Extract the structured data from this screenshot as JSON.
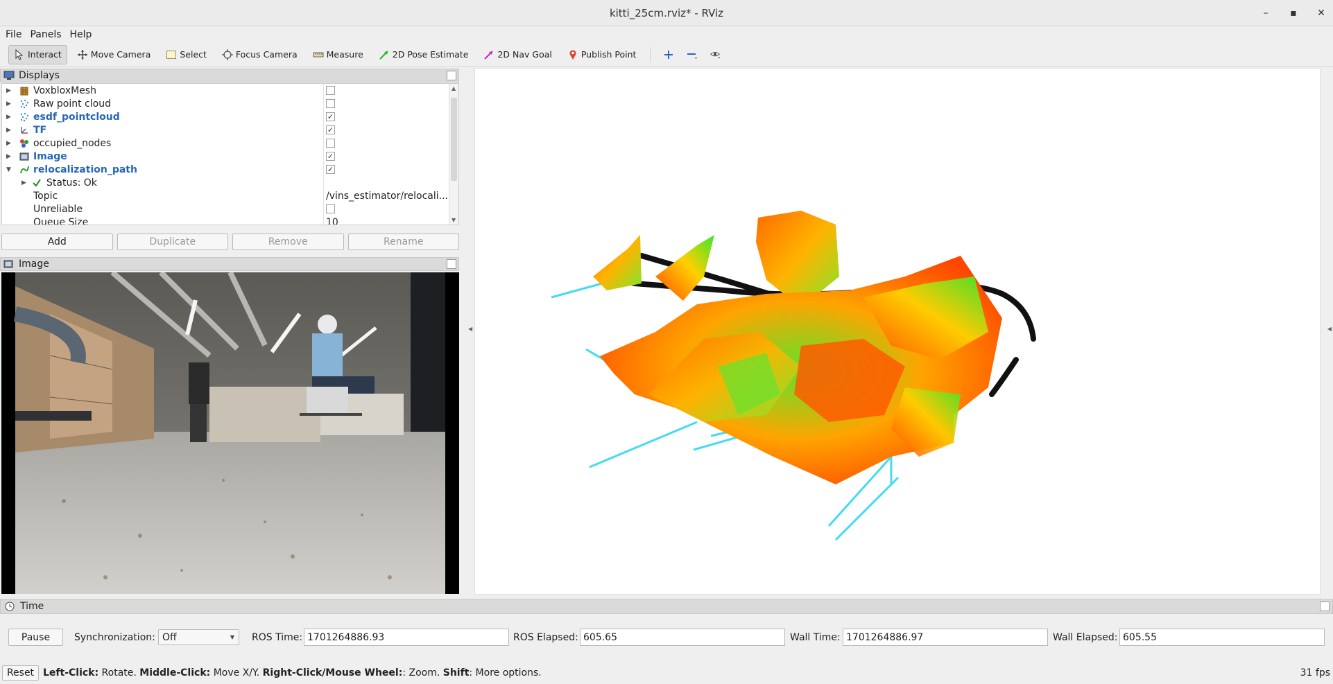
{
  "window": {
    "title": "kitti_25cm.rviz* - RViz"
  },
  "menu": [
    "File",
    "Panels",
    "Help"
  ],
  "toolbar": {
    "tools": [
      {
        "label": "Interact",
        "icon": "cursor-icon"
      },
      {
        "label": "Move Camera",
        "icon": "move-icon"
      },
      {
        "label": "Select",
        "icon": "select-box-icon"
      },
      {
        "label": "Focus Camera",
        "icon": "focus-icon"
      },
      {
        "label": "Measure",
        "icon": "ruler-icon"
      },
      {
        "label": "2D Pose Estimate",
        "icon": "pose-arrow-icon"
      },
      {
        "label": "2D Nav Goal",
        "icon": "nav-arrow-icon"
      },
      {
        "label": "Publish Point",
        "icon": "map-pin-icon"
      }
    ]
  },
  "displays": {
    "title": "Displays",
    "items": [
      {
        "label": "VoxbloxMesh",
        "checked": false,
        "highlight": false,
        "icon": "mesh-icon"
      },
      {
        "label": "Raw point cloud",
        "checked": false,
        "highlight": false,
        "icon": "pointcloud-icon"
      },
      {
        "label": "esdf_pointcloud",
        "checked": true,
        "highlight": true,
        "icon": "pointcloud-icon"
      },
      {
        "label": "TF",
        "checked": true,
        "highlight": true,
        "icon": "tf-icon"
      },
      {
        "label": "occupied_nodes",
        "checked": false,
        "highlight": false,
        "icon": "marker-icon"
      },
      {
        "label": "Image",
        "checked": true,
        "highlight": true,
        "icon": "image-icon"
      },
      {
        "label": "relocalization_path",
        "checked": true,
        "highlight": true,
        "icon": "path-icon"
      }
    ],
    "status": {
      "label": "Status: Ok"
    },
    "props": [
      {
        "label": "Topic",
        "value": "/vins_estimator/relocali..."
      },
      {
        "label": "Unreliable",
        "value": ""
      },
      {
        "label": "Queue Size",
        "value": "10"
      }
    ],
    "buttons": {
      "add": "Add",
      "duplicate": "Duplicate",
      "remove": "Remove",
      "rename": "Rename"
    }
  },
  "image_panel": {
    "title": "Image"
  },
  "time": {
    "title": "Time",
    "pause": "Pause",
    "sync_label": "Synchronization:",
    "sync_value": "Off",
    "ros_time_label": "ROS Time:",
    "ros_time": "1701264886.93",
    "ros_elapsed_label": "ROS Elapsed:",
    "ros_elapsed": "605.65",
    "wall_time_label": "Wall Time:",
    "wall_time": "1701264886.97",
    "wall_elapsed_label": "Wall Elapsed:",
    "wall_elapsed": "605.55"
  },
  "status": {
    "reset": "Reset",
    "hint_parts": [
      {
        "b": "Left-Click:",
        "t": " Rotate. "
      },
      {
        "b": "Middle-Click:",
        "t": " Move X/Y. "
      },
      {
        "b": "Right-Click/Mouse Wheel:",
        "t": ": Zoom. "
      },
      {
        "b": "Shift",
        "t": ": More options."
      }
    ],
    "fps": "31 fps"
  }
}
